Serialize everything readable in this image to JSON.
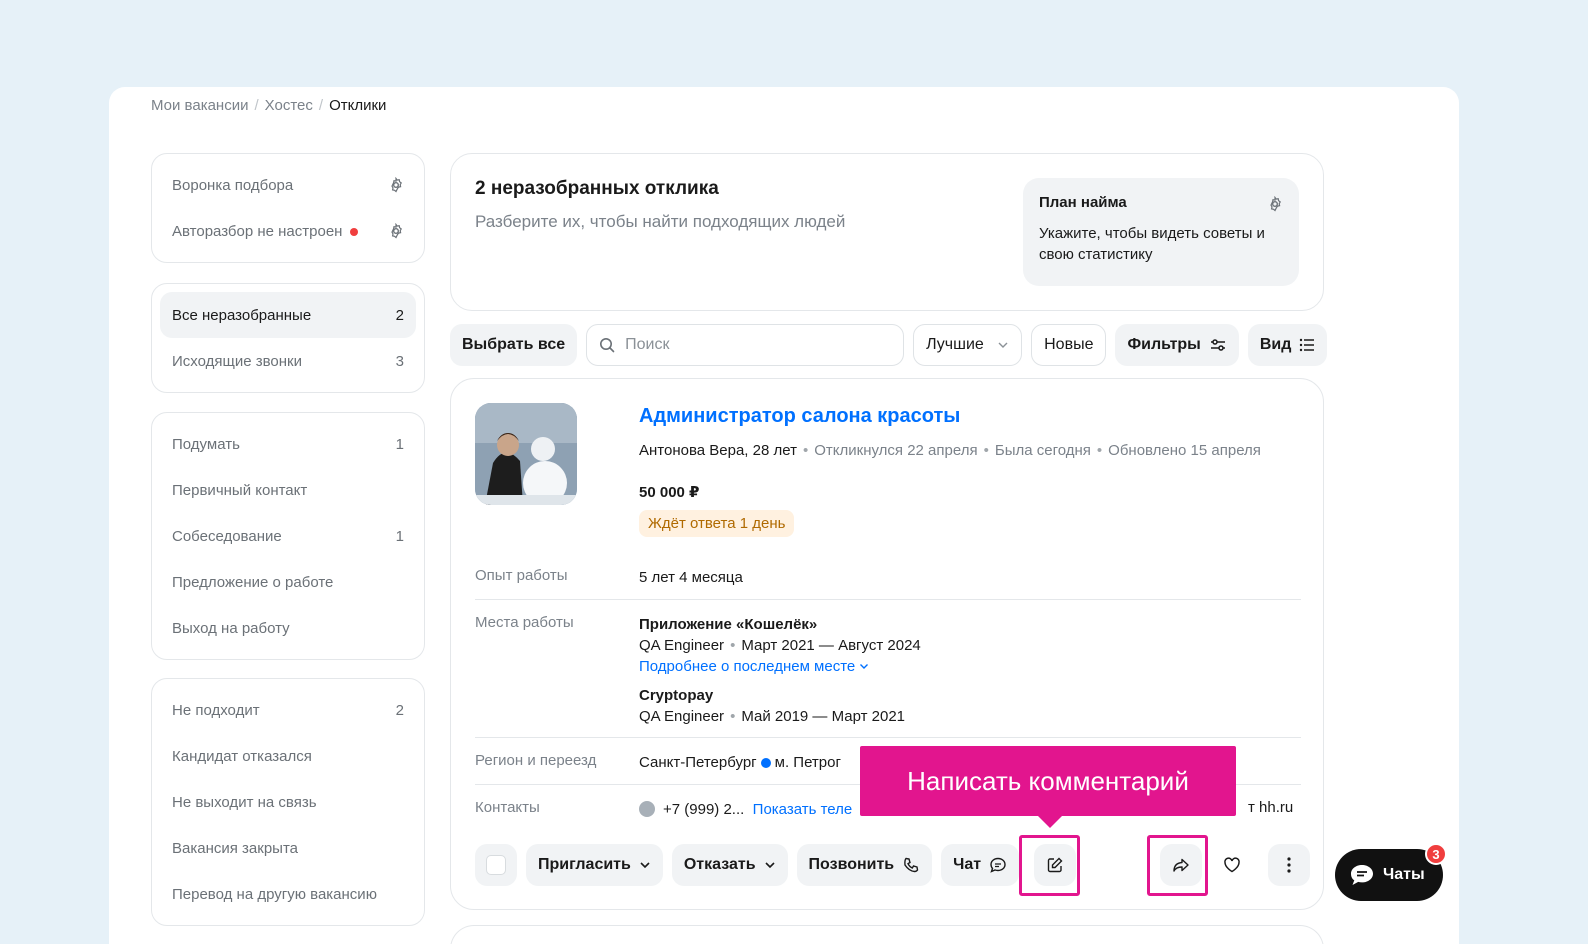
{
  "breadcrumb": [
    "Мои вакансии",
    "Хостес",
    "Отклики"
  ],
  "sidebar": {
    "group1": [
      {
        "label": "Воронка подбора"
      },
      {
        "label": "Авторазбор не настроен"
      }
    ],
    "group2": [
      {
        "label": "Все неразобранные",
        "count": "2",
        "active": true
      },
      {
        "label": "Исходящие звонки",
        "count": "3"
      }
    ],
    "group3": [
      {
        "label": "Подумать",
        "count": "1"
      },
      {
        "label": "Первичный контакт",
        "count": ""
      },
      {
        "label": "Собеседование",
        "count": "1"
      },
      {
        "label": "Предложение о работе",
        "count": ""
      },
      {
        "label": "Выход на работу",
        "count": ""
      }
    ],
    "group4": [
      {
        "label": "Не подходит",
        "count": "2"
      },
      {
        "label": "Кандидат отказался",
        "count": ""
      },
      {
        "label": "Не выходит на связь",
        "count": ""
      },
      {
        "label": "Вакансия закрыта",
        "count": ""
      },
      {
        "label": "Перевод на другую вакансию",
        "count": ""
      }
    ]
  },
  "summary": {
    "title": "2 неразобранных отклика",
    "subtitle": "Разберите их, чтобы найти подходящих людей",
    "plan_title": "План найма",
    "plan_text": "Укажите, чтобы видеть советы и свою статистику"
  },
  "toolbar": {
    "select_all": "Выбрать все",
    "search_placeholder": "Поиск",
    "sort": "Лучшие",
    "new": "Новые",
    "filters": "Фильтры",
    "view": "Вид"
  },
  "candidate": {
    "vacancy": "Администратор салона красоты",
    "name": "Антонова Вера, 28 лет",
    "responded": "Откликнулся 22 апреля",
    "seen": "Была сегодня",
    "updated": "Обновлено 15 апреля",
    "salary": "50 000 ₽",
    "status": "Ждёт ответа 1 день",
    "experience_label": "Опыт работы",
    "experience": "5 лет 4 месяца",
    "jobs_label": "Места работы",
    "jobs": [
      {
        "company": "Приложение «Кошелёк»",
        "role": "QA Engineer",
        "period": "Март 2021 — Август 2024"
      },
      {
        "company": "Cryptopay",
        "role": "QA Engineer",
        "period": "Май 2019 — Март 2021"
      }
    ],
    "more_link": "Подробнее о последнем месте",
    "region_label": "Регион и переезд",
    "region": "Санкт-Петербург",
    "metro": "м. Петрог",
    "contacts_label": "Контакты",
    "phone": "+7 (999) 2...",
    "show_phone": "Показать теле",
    "contacts_tail": "т hh.ru"
  },
  "actions": {
    "invite": "Пригласить",
    "reject": "Отказать",
    "call": "Позвонить",
    "chat": "Чат"
  },
  "tooltip": "Написать комментарий",
  "chats": {
    "label": "Чаты",
    "badge": "3"
  },
  "colors": {
    "accent": "#0070ff",
    "highlight": "#e2158e",
    "background": "#e6f1f8"
  }
}
